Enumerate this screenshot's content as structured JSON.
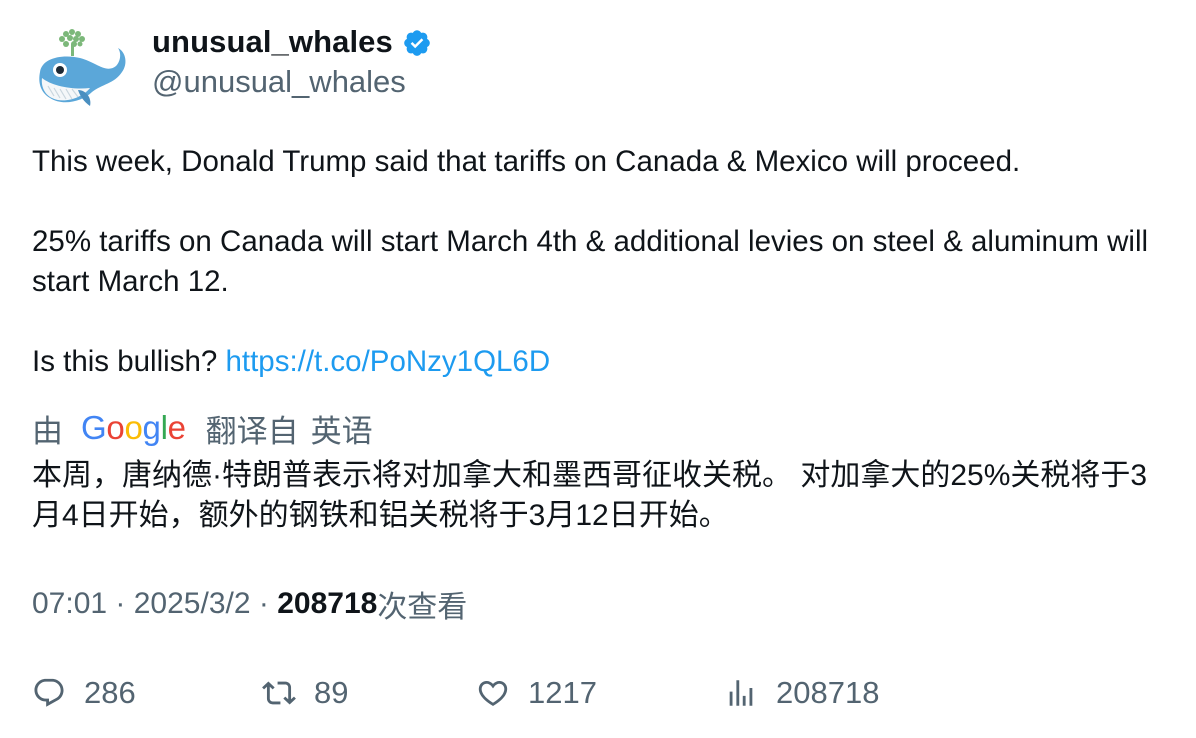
{
  "author": {
    "display_name": "unusual_whales",
    "handle": "@unusual_whales",
    "verified": true,
    "verified_color": "#1d9bf0",
    "avatar_icon": "whale-icon"
  },
  "tweet": {
    "line1": "This week, Donald Trump said that tariffs on Canada & Mexico will proceed.",
    "line2": "25% tariffs on Canada will start March 4th & additional levies on steel & aluminum will start March 12.",
    "line3_prefix": "Is this bullish? ",
    "link": "https://t.co/PoNzy1QL6D"
  },
  "translation": {
    "by_label": "由",
    "provider": "Google",
    "translated_from": "翻译自",
    "language": "英语",
    "text": "本周，唐纳德·特朗普表示将对加拿大和墨西哥征收关税。 对加拿大的25%关税将于3月4日开始，额外的钢铁和铝关税将于3月12日开始。"
  },
  "meta": {
    "time": "07:01",
    "separator": " · ",
    "date": "2025/3/2",
    "views": "208718",
    "views_label": "次查看"
  },
  "actions": {
    "replies": "286",
    "retweets": "89",
    "likes": "1217",
    "views": "208718"
  },
  "colors": {
    "text": "#0f1419",
    "secondary": "#536471",
    "link": "#1d9bf0"
  }
}
